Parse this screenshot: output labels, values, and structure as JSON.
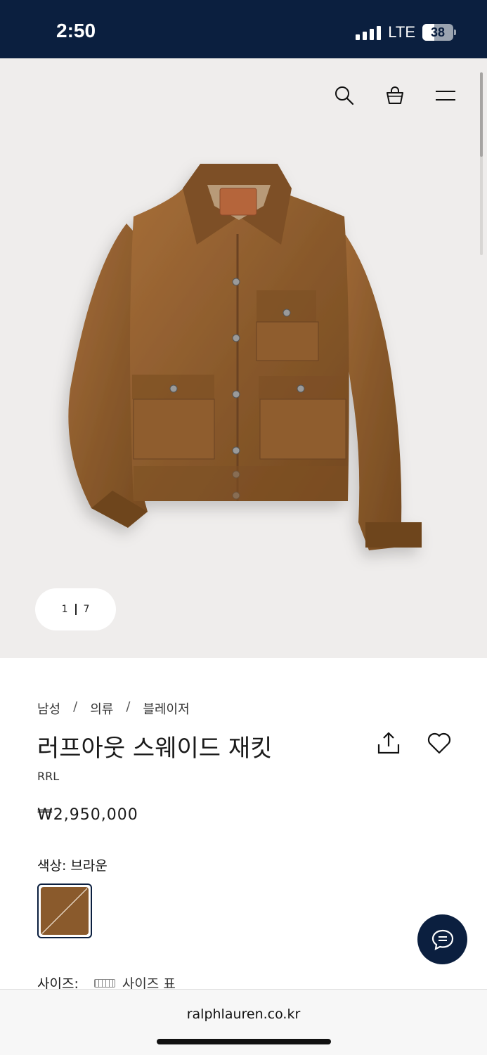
{
  "status": {
    "time": "2:50",
    "network": "LTE",
    "battery": "38",
    "battery_level": 0.38
  },
  "hero": {
    "image_alt": "Brown suede jacket",
    "pager": {
      "current": "1",
      "total": "7"
    }
  },
  "product": {
    "breadcrumb": [
      "남성",
      "의류",
      "블레이저"
    ],
    "title": "러프아웃 스웨이드 재킷",
    "brand": "RRL",
    "price": "₩2,950,000",
    "color_label": "색상: 브라운",
    "size_label": "사이즈:",
    "size_chart_label": "사이즈 표"
  },
  "browser": {
    "url": "ralphlauren.co.kr"
  },
  "colors": {
    "navy": "#0b1f3f",
    "suede": "#8a5a2c",
    "hero_bg": "#efedec"
  },
  "icons": [
    "search-icon",
    "bag-icon",
    "menu-icon",
    "share-icon",
    "heart-icon",
    "chat-icon",
    "ruler-icon"
  ]
}
